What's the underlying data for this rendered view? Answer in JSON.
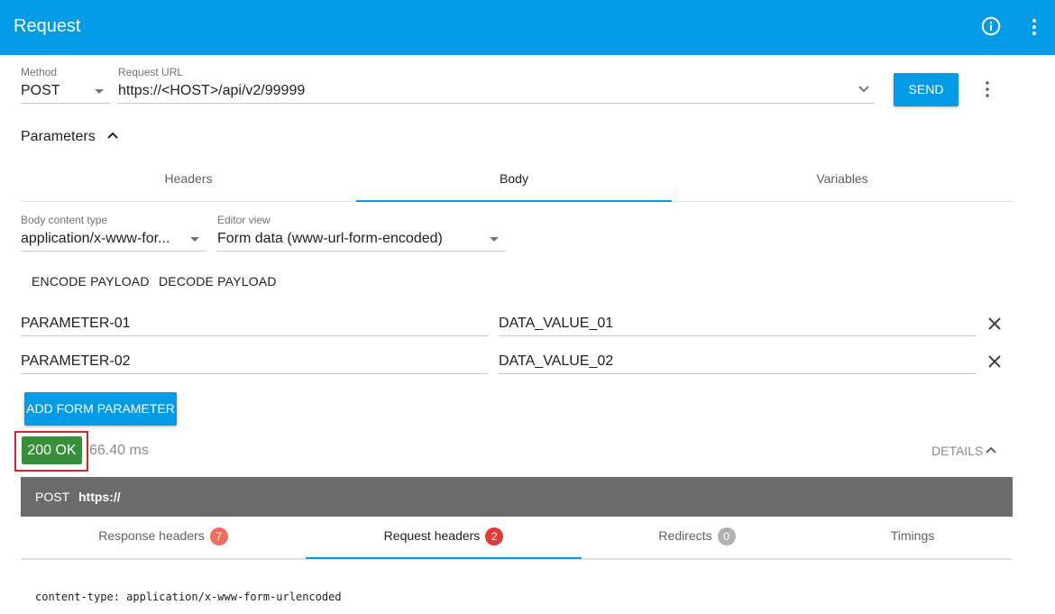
{
  "appbar": {
    "title": "Request",
    "info_icon": "info-icon",
    "menu_icon": "more-vert-icon",
    "color": "#039be5"
  },
  "request": {
    "method_label": "Method",
    "method_value": "POST",
    "url_label": "Request URL",
    "url_value": "https://<HOST>/api/v2/99999",
    "send_label": "SEND"
  },
  "parameters": {
    "title": "Parameters",
    "tabs": [
      {
        "label": "Headers",
        "active": false
      },
      {
        "label": "Body",
        "active": true
      },
      {
        "label": "Variables",
        "active": false
      }
    ]
  },
  "body": {
    "content_type_label": "Body content type",
    "content_type_value": "application/x-www-for...",
    "editor_view_label": "Editor view",
    "editor_view_value": "Form data (www-url-form-encoded)",
    "encode_label": "ENCODE PAYLOAD",
    "decode_label": "DECODE PAYLOAD",
    "form_params": [
      {
        "name": "PARAMETER-01",
        "value": "DATA_VALUE_01"
      },
      {
        "name": "PARAMETER-02",
        "value": "DATA_VALUE_02"
      }
    ],
    "add_label": "ADD FORM PARAMETER"
  },
  "response": {
    "status": "200 OK",
    "status_color": "#388e3c",
    "time": "66.40 ms",
    "details_label": "DETAILS",
    "bar_method": "POST",
    "bar_url": "https://",
    "tabs": [
      {
        "label": "Response headers",
        "count": "7",
        "count_color": "#f26c5f",
        "active": false
      },
      {
        "label": "Request headers",
        "count": "2",
        "count_color": "#e53935",
        "active": true
      },
      {
        "label": "Redirects",
        "count": "0",
        "count_color": "#b0b0b0",
        "active": false
      },
      {
        "label": "Timings",
        "count": "",
        "active": false
      }
    ],
    "header_line": "content-type: application/x-www-form-urlencoded"
  }
}
